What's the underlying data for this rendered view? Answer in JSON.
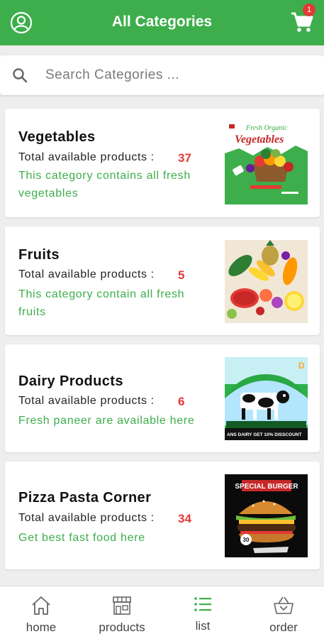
{
  "header": {
    "title": "All Categories",
    "cart_badge": "1",
    "profile_icon": "profile-icon",
    "cart_icon": "cart-icon"
  },
  "search": {
    "placeholder": "Search Categories ...",
    "value": "",
    "icon": "search-icon"
  },
  "colors": {
    "brand_green": "#3dae4b",
    "count_red": "#e53935"
  },
  "categories": [
    {
      "name": "Vegetables",
      "total_label": "Total available products :",
      "count": "37",
      "description": "This category contains all fresh vegetables",
      "image_text": [
        "Fresh Organic",
        "Vegetables"
      ]
    },
    {
      "name": "Fruits",
      "total_label": "Total available products :",
      "count": "5",
      "description": "This category contain all fresh fruits"
    },
    {
      "name": "Dairy Products",
      "total_label": "Total available products :",
      "count": "6",
      "description": "Fresh paneer are available here",
      "image_text": [
        "ANS DAIRY GET 10% DISSCOUNT"
      ]
    },
    {
      "name": "Pizza Pasta Corner",
      "total_label": "Total available products :",
      "count": "34",
      "description": "Get best fast food here",
      "image_text": [
        "SPECIAL BURGER",
        "30"
      ]
    }
  ],
  "bottom_nav": [
    {
      "label": "home",
      "icon": "home-icon",
      "active": false
    },
    {
      "label": "products",
      "icon": "store-icon",
      "active": false
    },
    {
      "label": "list",
      "icon": "list-icon",
      "active": true
    },
    {
      "label": "order",
      "icon": "basket-icon",
      "active": false
    }
  ]
}
